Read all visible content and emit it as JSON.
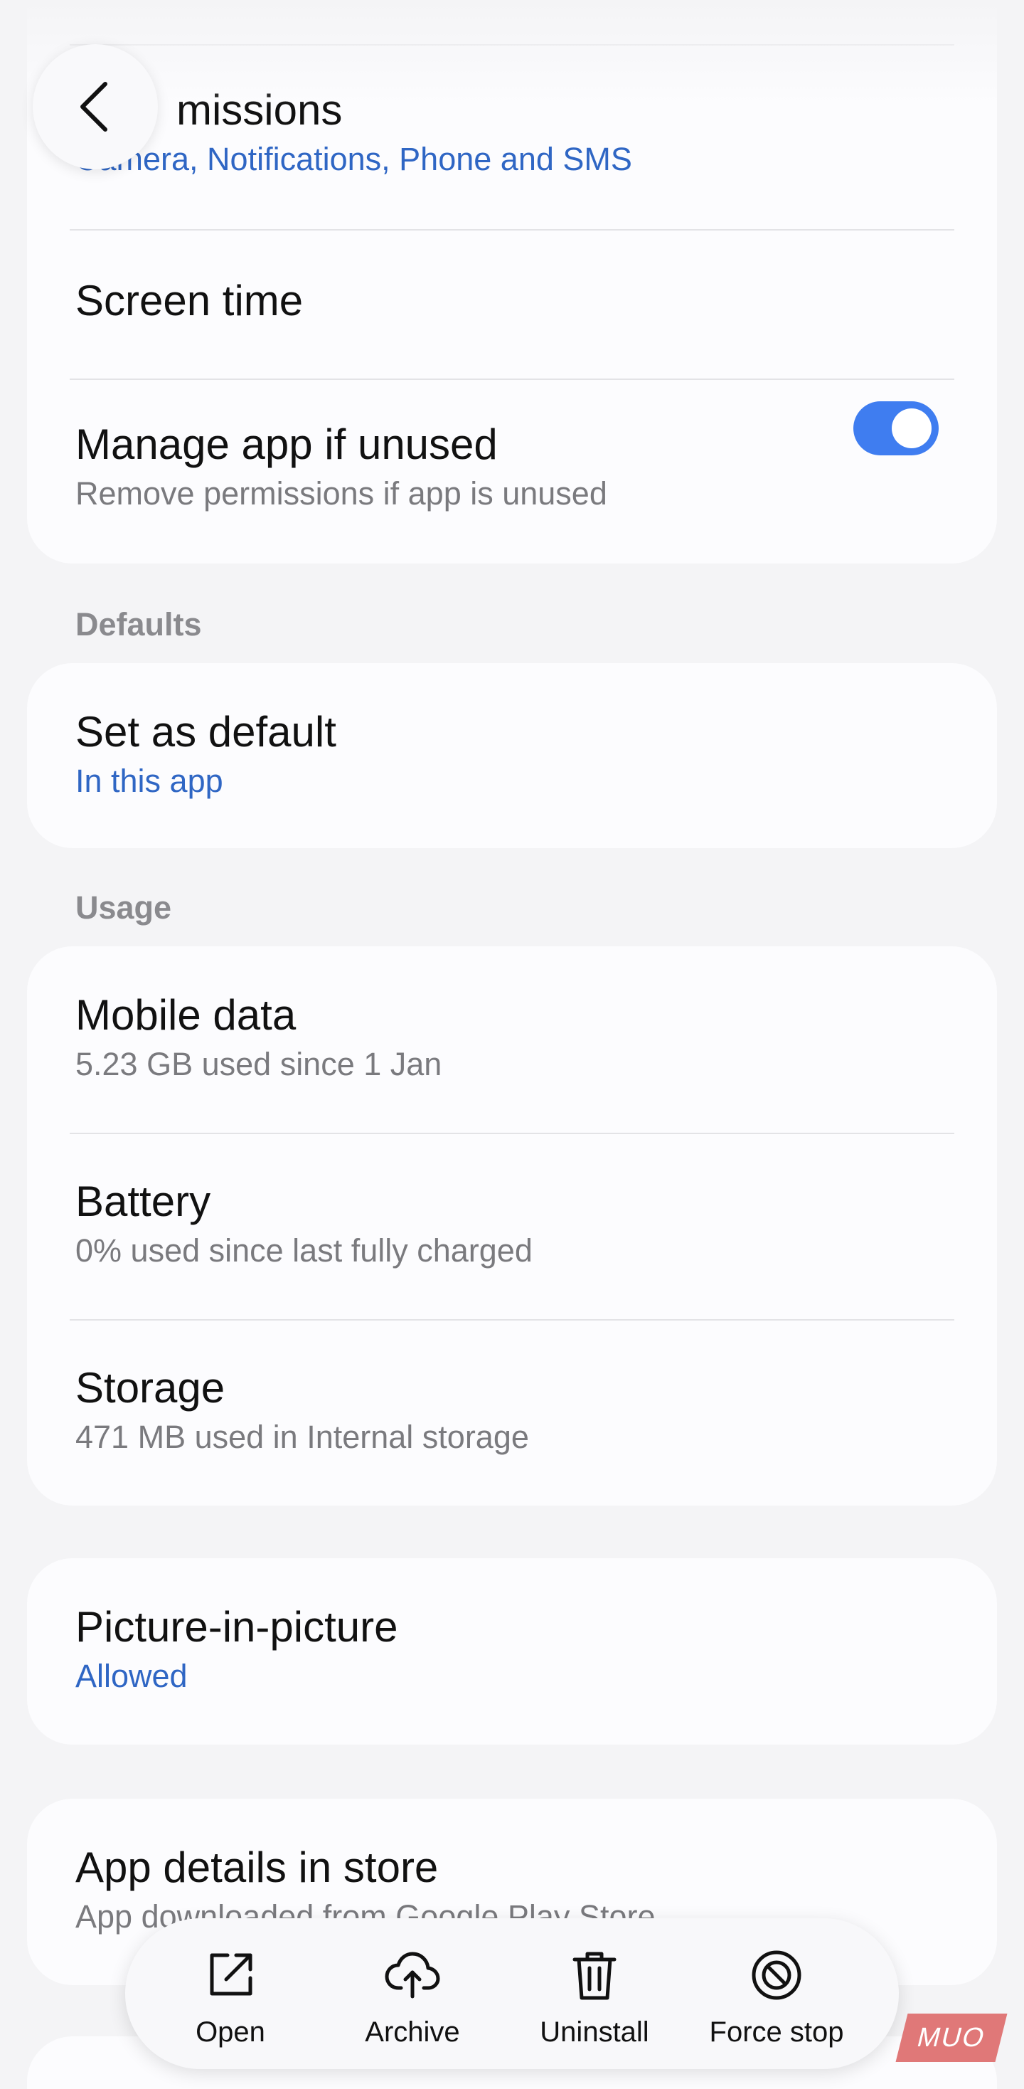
{
  "app_info": {
    "permissions": {
      "title": "Permissions",
      "visible_title": "missions",
      "value": "Camera, Notifications, Phone and SMS"
    },
    "screen_time": {
      "title": "Screen time"
    },
    "manage_unused": {
      "title": "Manage app if unused",
      "subtitle": "Remove permissions if app is unused",
      "enabled": true
    }
  },
  "defaults": {
    "section_label": "Defaults",
    "set_as_default": {
      "title": "Set as default",
      "value": "In this app"
    }
  },
  "usage": {
    "section_label": "Usage",
    "mobile_data": {
      "title": "Mobile data",
      "subtitle": "5.23 GB used since 1 Jan"
    },
    "battery": {
      "title": "Battery",
      "subtitle": "0% used since last fully charged"
    },
    "storage": {
      "title": "Storage",
      "subtitle": "471 MB used in Internal storage"
    }
  },
  "pip": {
    "title": "Picture-in-picture",
    "value": "Allowed"
  },
  "store": {
    "title": "App details in store",
    "subtitle": "App downloaded from Google Play Store"
  },
  "actions": {
    "open": "Open",
    "archive": "Archive",
    "uninstall": "Uninstall",
    "force_stop": "Force stop"
  },
  "watermark": {
    "text": "MUO"
  },
  "colors": {
    "accent_blue": "#2f66c4",
    "toggle_on": "#3f7df0",
    "background": "#f4f4f6",
    "card": "#fcfcfe"
  }
}
